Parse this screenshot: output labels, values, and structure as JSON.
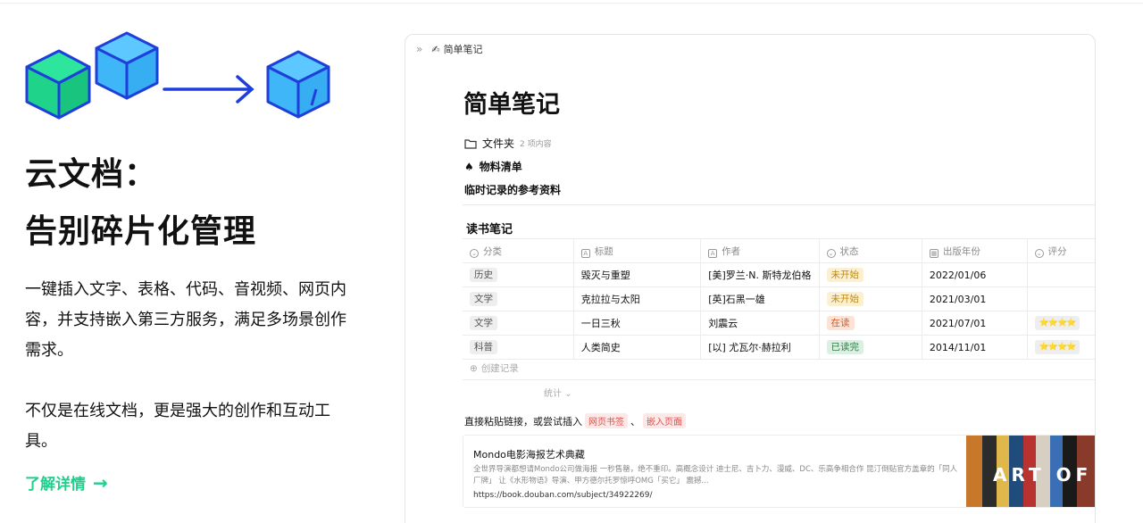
{
  "left": {
    "heading_line1": "云文档：",
    "heading_line2": "告别碎片化管理",
    "desc1": "一键插入文字、表格、代码、音视频、网页内容，并支持嵌入第三方服务，满足多场景创作需求。",
    "desc2": "不仅是在线文档，更是强大的创作和互动工具。",
    "learn_more": "了解详情",
    "accent_color": "#1fcf8c"
  },
  "panel": {
    "breadcrumb_icon": "✍",
    "breadcrumb": "简单笔记",
    "title": "简单笔记",
    "folder_label": "文件夹",
    "folder_count": "2 项内容",
    "spade_label": "物料清单",
    "ref_label": "临时记录的参考资料",
    "section_title": "读书笔记",
    "columns": [
      "分类",
      "标题",
      "作者",
      "状态",
      "出版年份",
      "评分"
    ],
    "rows": [
      {
        "category": "历史",
        "title": "毁灭与重塑",
        "author": "[美]罗兰·N. 斯特龙伯格",
        "status": "未开始",
        "status_color": "yellow",
        "year": "2022/01/06",
        "rating": ""
      },
      {
        "category": "文学",
        "title": "克拉拉与太阳",
        "author": "[英]石黑一雄",
        "status": "未开始",
        "status_color": "yellow",
        "year": "2021/03/01",
        "rating": ""
      },
      {
        "category": "文学",
        "title": "一日三秋",
        "author": "刘震云",
        "status": "在读",
        "status_color": "orange",
        "year": "2021/07/01",
        "rating": "⭐⭐⭐⭐"
      },
      {
        "category": "科普",
        "title": "人类简史",
        "author": "[以] 尤瓦尔·赫拉利",
        "status": "已读完",
        "status_color": "green",
        "year": "2014/11/01",
        "rating": "⭐⭐⭐⭐"
      }
    ],
    "add_record": "创建记录",
    "stats": "统计",
    "paste_hint": "直接粘贴链接，或尝试插入",
    "pill_bookmark": "网页书签",
    "pill_separator": "、",
    "pill_embed": "嵌入页面",
    "card": {
      "title": "Mondo电影海报艺术典藏",
      "description": "全世界导演都想请Mondo公司做海报 一秒售罄，绝不重印。高概念设计 迪士尼、吉卜力、漫威、DC、乐高争相合作 昆汀倒贴官方盖章的「同人厂牌」 让《水形物语》导演、甲方德尔托罗惊呼OMG「买它」 震撼...",
      "url": "https://book.douban.com/subject/34922269/",
      "poster_text": "ART OF"
    }
  }
}
